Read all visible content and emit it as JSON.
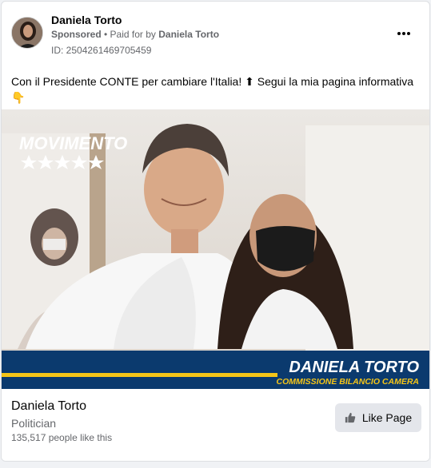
{
  "post": {
    "page_name": "Daniela Torto",
    "sponsored_label": "Sponsored",
    "separator": " • ",
    "paid_for_prefix": "Paid for by ",
    "paid_for_name": "Daniela Torto",
    "id_line": "ID: 2504261469705459",
    "ad_text": "Con il Presidente CONTE per cambiare l'Italia! ⬆ Segui la mia pagina informativa",
    "ad_emoji": "👇",
    "more_icon": "more-horizontal-icon"
  },
  "creative": {
    "logo_text": "MOVIMENTO",
    "stars_count": 5,
    "banner_name": "DANIELA TORTO",
    "banner_role": "COMMISSIONE BILANCIO CAMERA",
    "colors": {
      "banner_blue": "#0b3a6e",
      "banner_yellow": "#f5c518"
    }
  },
  "cta": {
    "name": "Daniela Torto",
    "category": "Politician",
    "likes": "135,517 people like this",
    "button_label": "Like Page",
    "button_icon": "thumbs-up-icon"
  }
}
